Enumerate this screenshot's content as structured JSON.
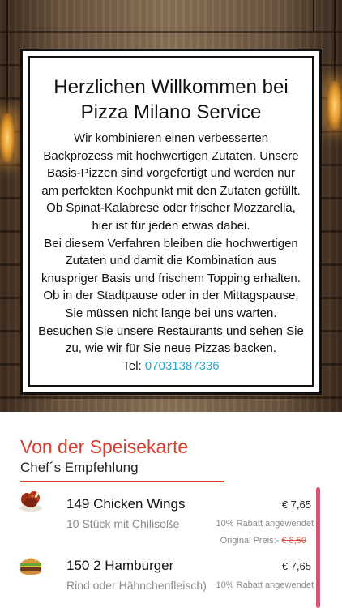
{
  "hero": {
    "title_line1": "Herzlichen Willkommen bei",
    "title_line2": "Pizza Milano Service",
    "paragraph1": "Wir kombinieren einen verbesserten Backprozess mit hochwertigen Zutaten. Unsere Basis-Pizzen sind vorgefertigt und werden nur am perfekten Kochpunkt mit den Zutaten gefüllt. Ob Spinat-Kalabrese oder frischer Mozzarella, hier ist für jeden etwas dabei.",
    "paragraph2": "Bei diesem Verfahren bleiben die hochwertigen Zutaten und damit die Kombination aus knuspriger Basis und frischem Topping erhalten.",
    "paragraph3": "Ob in der Stadtpause oder in der Mittagspause, Sie müssen nicht lange bei uns warten.",
    "paragraph4": "Besuchen Sie unsere Restaurants und sehen Sie zu, wie wir für Sie neue Pizzas backen.",
    "tel_label": "Tel: ",
    "tel_number": "07031387336"
  },
  "menu": {
    "title": "Von der Speisekarte",
    "subtitle": "Chef´s Empfehlung",
    "items": [
      {
        "name": "149  Chicken Wings",
        "description": "10 Stück mit Chilisoße",
        "price": "€ 7,65",
        "discount": "10% Rabatt angewendet",
        "original_label": "Original Preis:- ",
        "original_price": "€ 8,50",
        "icon": "chicken-wings-icon"
      },
      {
        "name": "150  2 Hamburger",
        "description": "Rind oder Hähnchenfleisch)",
        "price": "€ 7,65",
        "discount": "10% Rabatt angewendet",
        "icon": "hamburger-icon"
      }
    ]
  },
  "colors": {
    "accent_red": "#d93c2c",
    "phone_link": "#2aa6c9",
    "scroll_indicator": "#d25677"
  }
}
